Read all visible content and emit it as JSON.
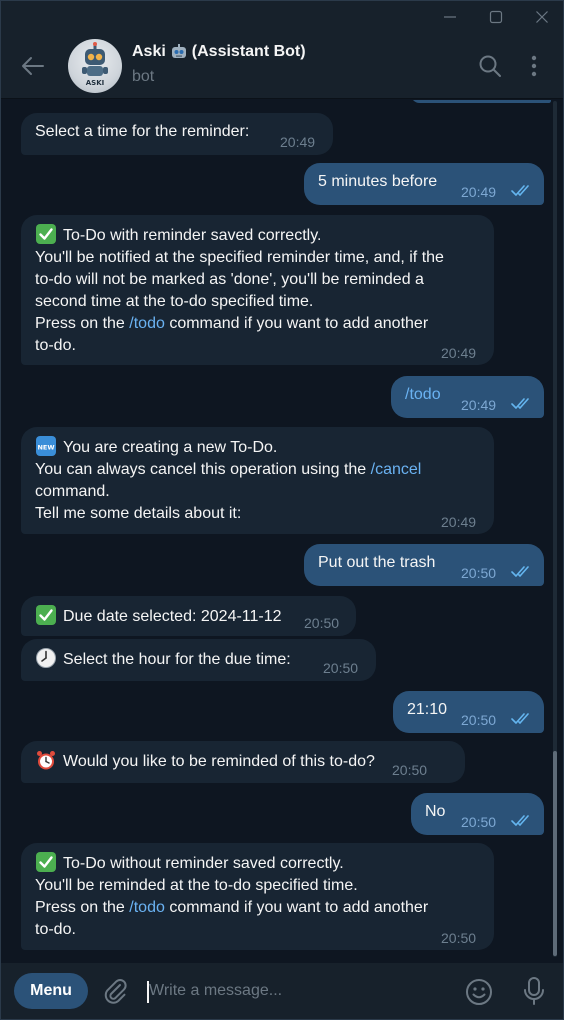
{
  "window": {
    "controls": [
      "minimize-icon",
      "maximize-icon",
      "close-icon"
    ]
  },
  "header": {
    "name_prefix": "Aski",
    "name_suffix": "(Assistant Bot)",
    "status": "bot",
    "avatar_text": "ASKI"
  },
  "messages": [
    {
      "dir": "in",
      "text": "Select a time for the reminder:",
      "time": "20:49"
    },
    {
      "dir": "out",
      "text": "5 minutes before",
      "time": "20:49"
    },
    {
      "dir": "in",
      "l1": "To-Do with reminder saved correctly.",
      "l2": "You'll be notified at the specified reminder time, and, if the",
      "l3": "to-do will not be marked as 'done', you'll be reminded a",
      "l4": "second time at the to-do specified time.",
      "l5a": "Press on the ",
      "l5link": "/todo",
      "l5b": " command if you want to add another",
      "l6": "to-do.",
      "time": "20:49"
    },
    {
      "dir": "out",
      "text": "/todo",
      "time": "20:49"
    },
    {
      "dir": "in",
      "l1": "You are creating a new To-Do.",
      "l2a": "You can always cancel this operation using the ",
      "l2link": "/cancel",
      "l3": "command.",
      "l4": "Tell me some details about it:",
      "time": "20:49"
    },
    {
      "dir": "out",
      "text": "Put out the trash",
      "time": "20:50"
    },
    {
      "dir": "in",
      "text": "Due date selected: 2024-11-12",
      "time": "20:50"
    },
    {
      "dir": "in",
      "text": "Select the hour for the due time:",
      "time": "20:50"
    },
    {
      "dir": "out",
      "text": "21:10",
      "time": "20:50"
    },
    {
      "dir": "in",
      "text": "Would you like to be reminded of this to-do?",
      "time": "20:50"
    },
    {
      "dir": "out",
      "text": "No",
      "time": "20:50"
    },
    {
      "dir": "in",
      "l1": "To-Do without reminder saved correctly.",
      "l2": "You'll be reminded at the to-do specified time.",
      "l3a": "Press on the ",
      "l3link": "/todo",
      "l3b": " command if you want to add another",
      "l4": "to-do.",
      "time": "20:50"
    }
  ],
  "composer": {
    "menu_label": "Menu",
    "placeholder": "Write a message..."
  },
  "colors": {
    "background": "#0e1621",
    "header": "#17212b",
    "incoming_bubble": "#182533",
    "outgoing_bubble": "#2b5278",
    "link": "#6ab2f2",
    "read_ticks": "#64b5ef"
  }
}
